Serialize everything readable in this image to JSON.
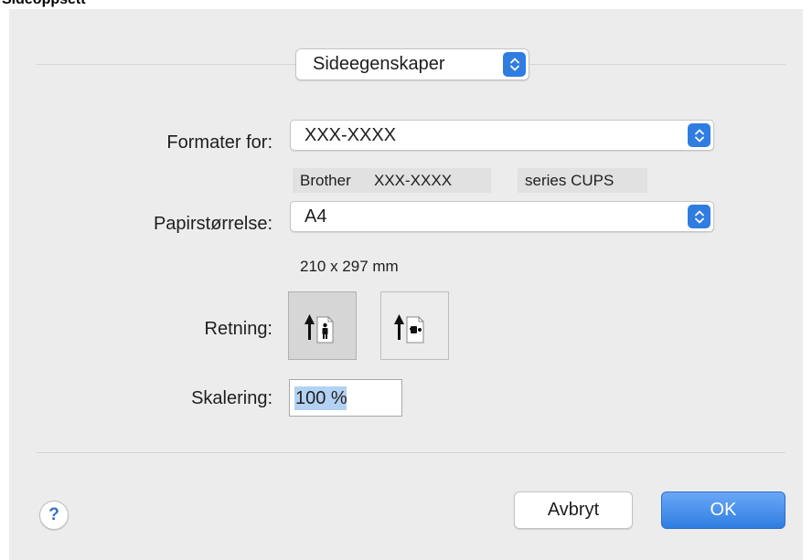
{
  "page": {
    "section_title": "Sideoppsett"
  },
  "top_popup": {
    "label": "Sideegenskaper"
  },
  "format_for": {
    "label": "Formater for:",
    "value": "XXX-XXXX"
  },
  "printer_desc": {
    "brand": "Brother",
    "model": "XXX-XXXX",
    "suffix": "series CUPS"
  },
  "paper_size": {
    "label": "Papirstørrelse:",
    "value": "A4",
    "dimensions": "210 x 297 mm"
  },
  "orientation": {
    "label": "Retning:",
    "options": [
      "portrait",
      "landscape"
    ],
    "selected": "portrait"
  },
  "scaling": {
    "label": "Skalering:",
    "value": "100 %"
  },
  "buttons": {
    "help": "?",
    "cancel": "Avbryt",
    "ok": "OK"
  },
  "colors": {
    "accent": "#2f7de1",
    "dialog_bg": "#ececec",
    "selection": "#b3d1f3"
  }
}
